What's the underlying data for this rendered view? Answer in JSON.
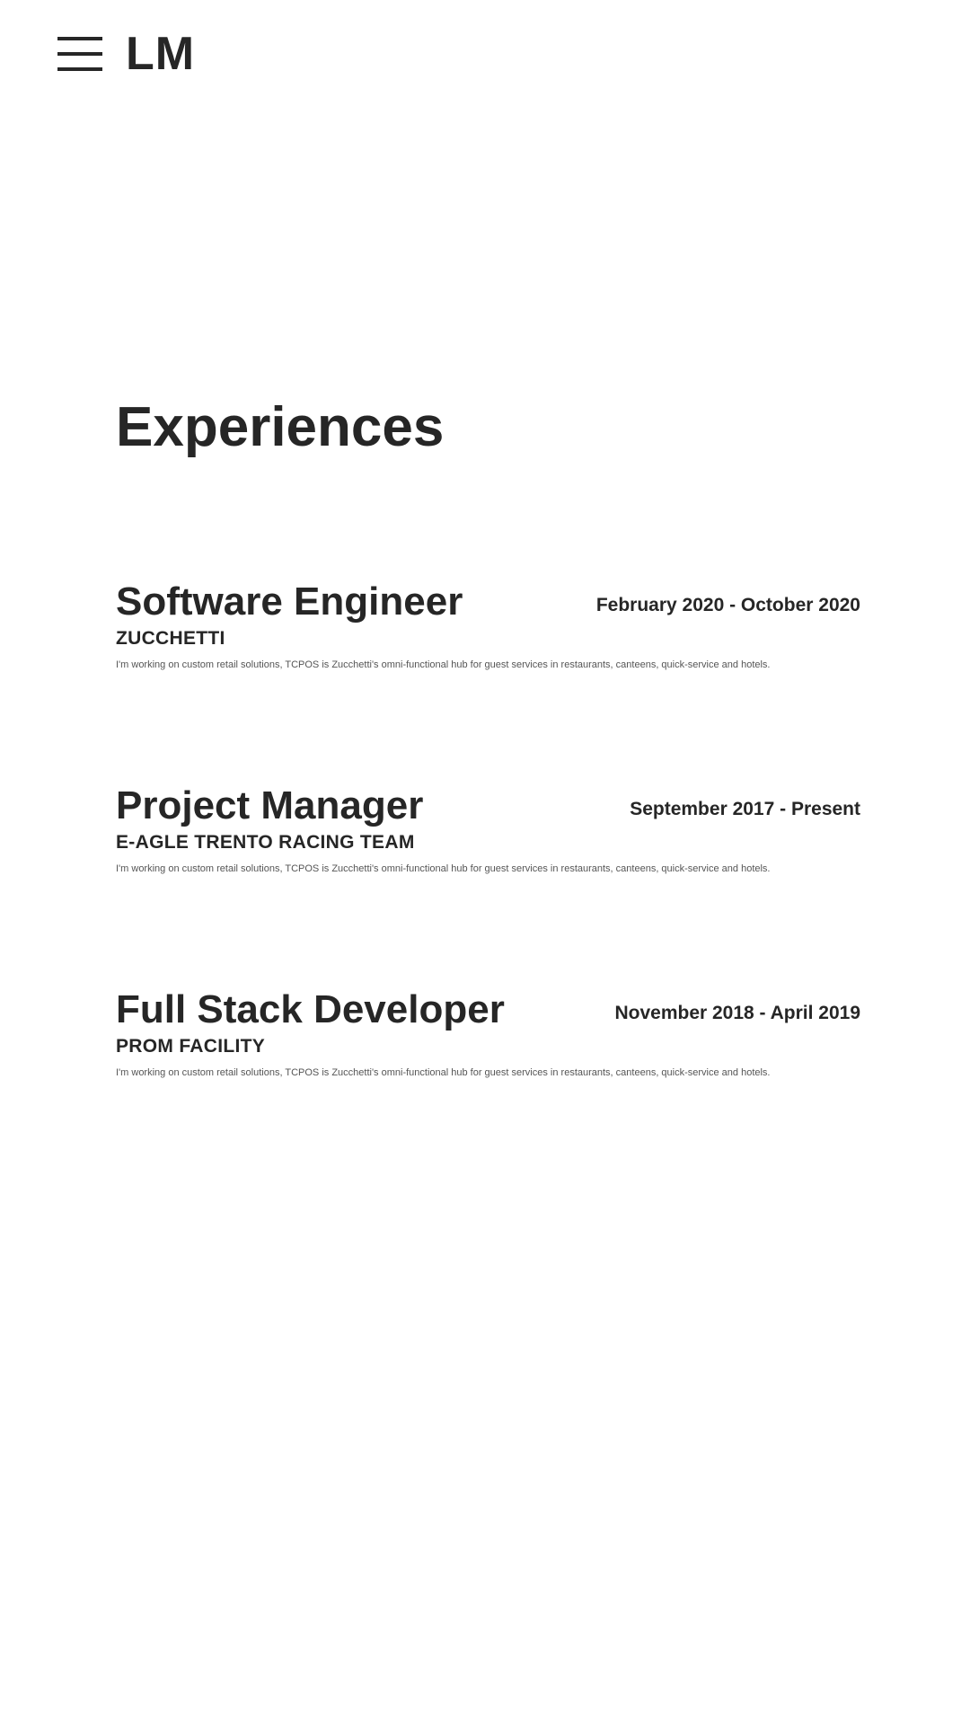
{
  "header": {
    "menu_icon": "hamburger-menu-icon",
    "logo": "LM"
  },
  "page": {
    "title": "Experiences"
  },
  "experiences": [
    {
      "role": "Software Engineer",
      "dates": "February 2020 - October 2020",
      "company": "ZUCCHETTI",
      "description": "I'm working on custom retail solutions, TCPOS is Zucchetti's omni-functional hub for guest services in restaurants, canteens, quick-service and hotels."
    },
    {
      "role": "Project Manager",
      "dates": "September 2017 - Present",
      "company": "E-AGLE TRENTO RACING TEAM",
      "description": "I'm working on custom retail solutions, TCPOS is Zucchetti's omni-functional hub for guest services in restaurants, canteens, quick-service and hotels."
    },
    {
      "role": "Full Stack Developer",
      "dates": "November 2018 - April 2019",
      "company": "PROM FACILITY",
      "description": "I'm working on custom retail solutions, TCPOS is Zucchetti's omni-functional hub for guest services in restaurants, canteens, quick-service and hotels."
    }
  ]
}
